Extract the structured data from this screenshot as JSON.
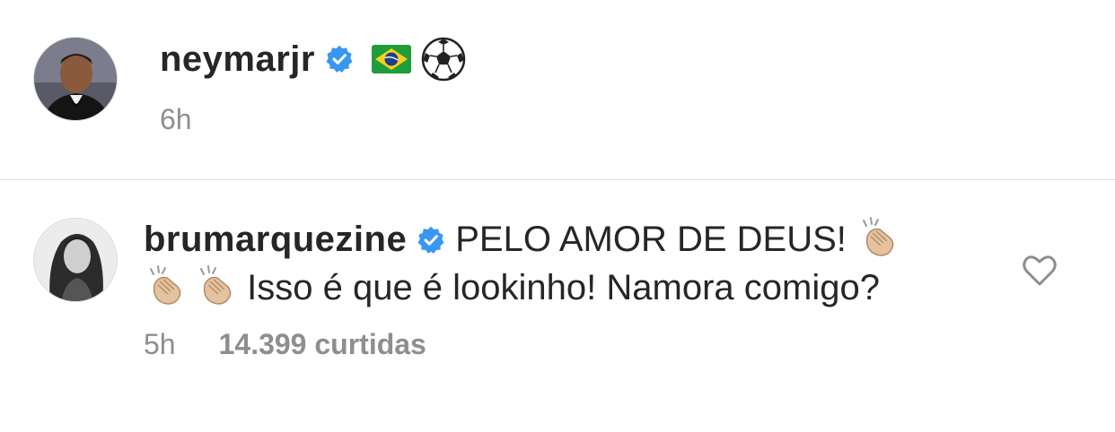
{
  "caption": {
    "username": "neymarjr",
    "avatar": "neymar-avatar",
    "verified": true,
    "emojis": [
      "brazil-flag",
      "soccer-ball"
    ],
    "time": "6h"
  },
  "comment": {
    "username": "brumarquezine",
    "avatar": "bruna-avatar",
    "verified": true,
    "text_part1": "PELO AMOR DE DEUS! ",
    "text_part2": " Isso é que é lookinho! Namora comigo?",
    "emojis": [
      "clapping-hands",
      "clapping-hands",
      "clapping-hands"
    ],
    "time": "5h",
    "likes": "14.399 curtidas",
    "like_icon": "heart-outline-icon"
  },
  "colors": {
    "primary_text": "#262626",
    "secondary_text": "#8e8e8e",
    "verified_blue": "#3897f0",
    "divider": "#dbdbdb"
  }
}
